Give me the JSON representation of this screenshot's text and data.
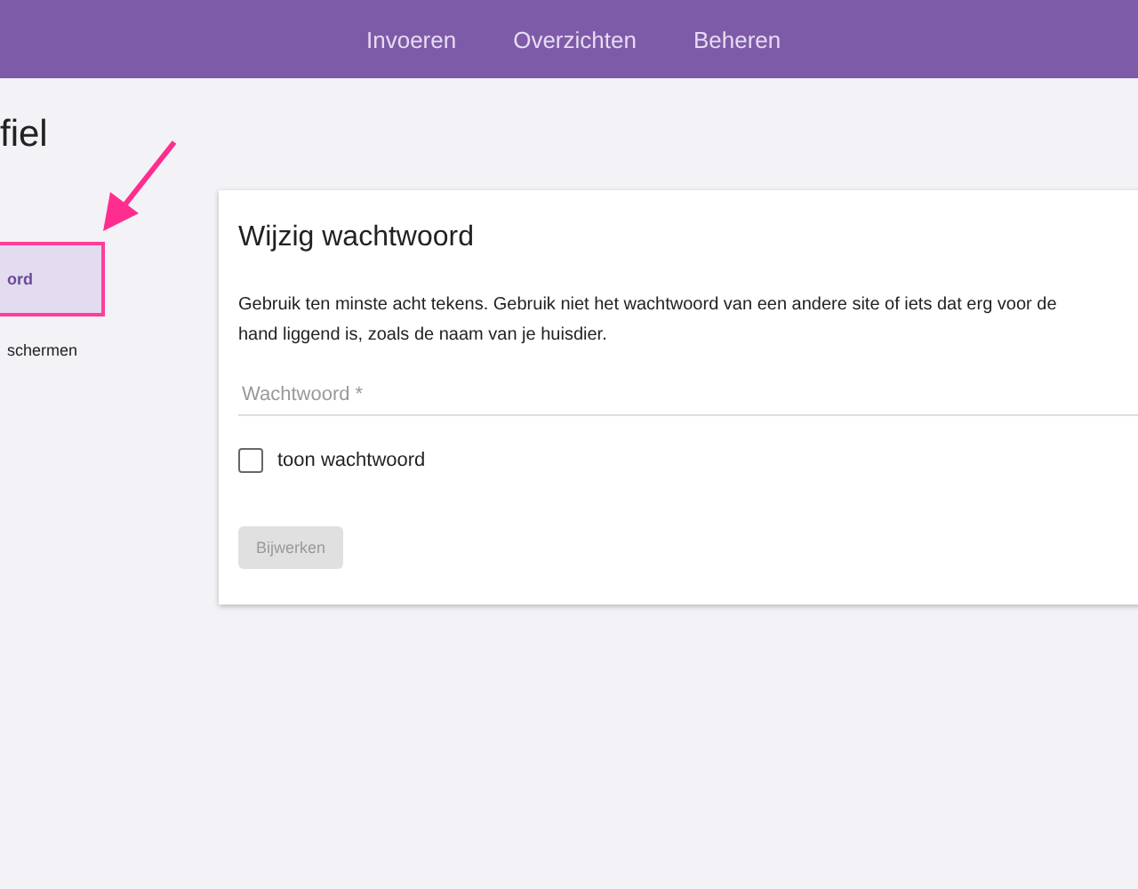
{
  "nav": [
    {
      "label": "Invoeren"
    },
    {
      "label": "Overzichten"
    },
    {
      "label": "Beheren"
    }
  ],
  "page_title": "fiel",
  "sidebar": {
    "items": [
      {
        "label": "ord",
        "selected": true
      },
      {
        "label": "schermen",
        "selected": false
      }
    ]
  },
  "card": {
    "title": "Wijzig wachtwoord",
    "description": "Gebruik ten minste acht tekens. Gebruik niet het wachtwoord van een andere site of iets dat erg voor de\nhand liggend is, zoals de naam van je huisdier.",
    "password_field": {
      "placeholder": "Wachtwoord *"
    },
    "show_password": {
      "label": "toon wachtwoord",
      "checked": false
    },
    "submit": {
      "label": "Bijwerken",
      "disabled": true
    }
  }
}
